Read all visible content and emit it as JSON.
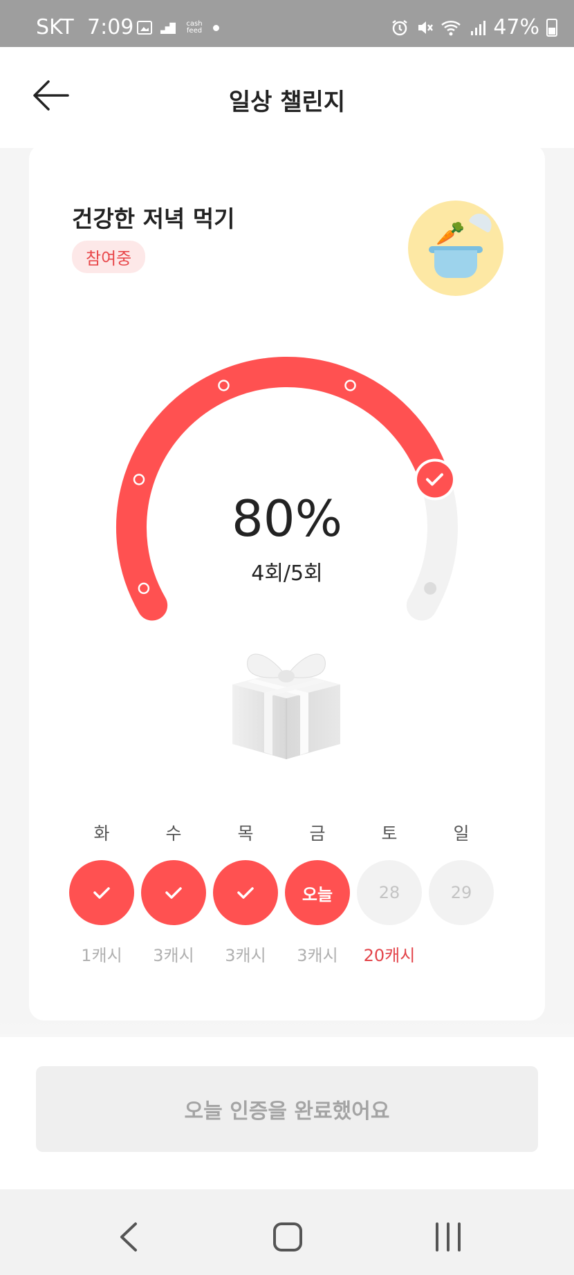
{
  "status_bar": {
    "carrier": "SKT",
    "time": "7:09",
    "cash_icon_text": "cash feed",
    "battery": "47%"
  },
  "header": {
    "title": "일상 챌린지"
  },
  "challenge": {
    "title": "건강한 저녁 먹기",
    "status_badge": "참여중",
    "progress_percent_text": "80%",
    "progress_fraction": 0.8,
    "count_text": "4회/5회",
    "checkpoints_done": 4,
    "checkpoints_total": 5
  },
  "week": [
    {
      "day": "화",
      "state": "done",
      "text": "",
      "reward": "1캐시"
    },
    {
      "day": "수",
      "state": "done",
      "text": "",
      "reward": "3캐시"
    },
    {
      "day": "목",
      "state": "done",
      "text": "",
      "reward": "3캐시"
    },
    {
      "day": "금",
      "state": "today",
      "text": "오늘",
      "reward": "3캐시"
    },
    {
      "day": "토",
      "state": "future",
      "text": "28",
      "reward": "20캐시"
    },
    {
      "day": "일",
      "state": "future",
      "text": "29",
      "reward": ""
    }
  ],
  "cta": {
    "label": "오늘 인증을 완료했어요"
  },
  "colors": {
    "accent": "#ff5151",
    "badge_bg": "#fde8e8",
    "track": "#f2f2f2"
  },
  "icons": {
    "back": "arrow-left-icon",
    "gift": "gift-box-icon",
    "check": "check-icon",
    "nav_back": "chevron-left-icon",
    "nav_home": "home-square-icon",
    "nav_recent": "recent-apps-icon"
  }
}
